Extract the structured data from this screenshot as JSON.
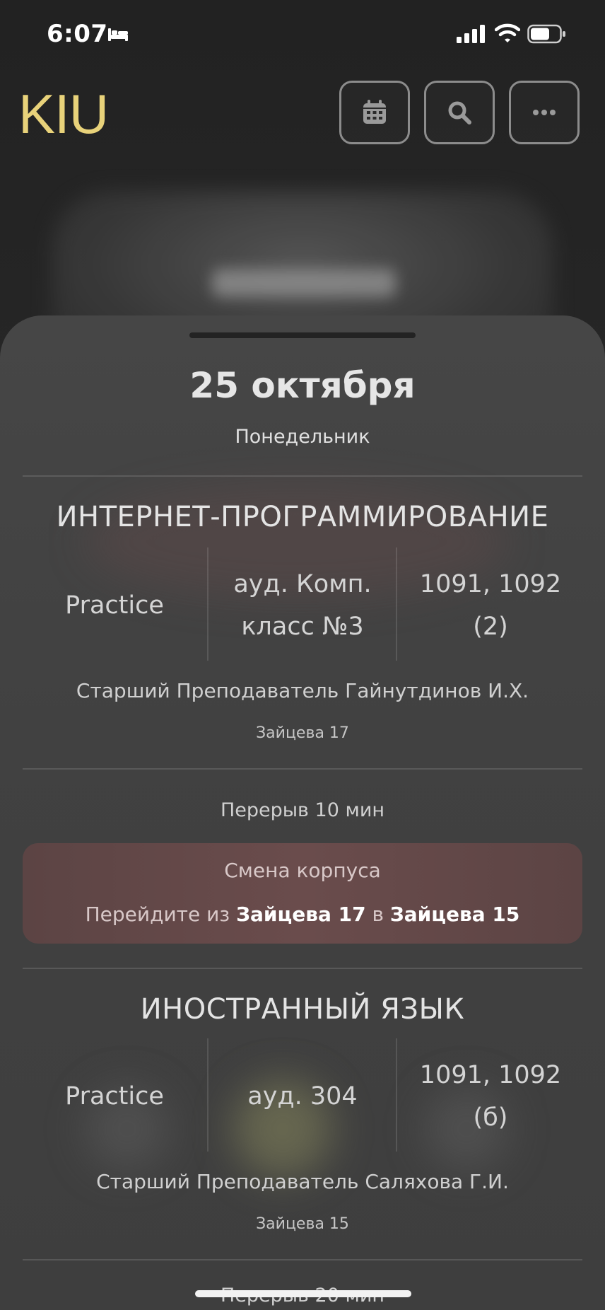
{
  "status_bar": {
    "time": "6:07"
  },
  "header": {
    "logo": "KIU"
  },
  "day": {
    "date": "25 октября",
    "weekday": "Понедельник"
  },
  "lessons": [
    {
      "subject": "ИНТЕРНЕТ-ПРОГРАММИРОВАНИЕ",
      "type": "Practice",
      "room_line1": "ауд. Комп.",
      "room_line2": "класс №3",
      "groups_line1": "1091, 1092",
      "groups_line2": "(2)",
      "teacher": "Старший Преподаватель Гайнутдинов И.Х.",
      "building": "Зайцева 17"
    },
    {
      "subject": "ИНОСТРАННЫЙ ЯЗЫК",
      "type": "Practice",
      "room_line1": "ауд. 304",
      "room_line2": "",
      "groups_line1": "1091, 1092",
      "groups_line2": "(б)",
      "teacher": "Старший Преподаватель Саляхова Г.И.",
      "building": "Зайцева 15"
    }
  ],
  "break1": "Перерыв 10 мин",
  "building_change": {
    "title": "Смена корпуса",
    "prefix": "Перейдите из",
    "from": "Зайцева 17",
    "middle": "в",
    "to": "Зайцева 15"
  },
  "break2": "Перерыв 20 мин",
  "colors": {
    "accent": "#e8d27a",
    "alert_bg": "#6a4c4c",
    "sheet_bg": "#434343"
  }
}
